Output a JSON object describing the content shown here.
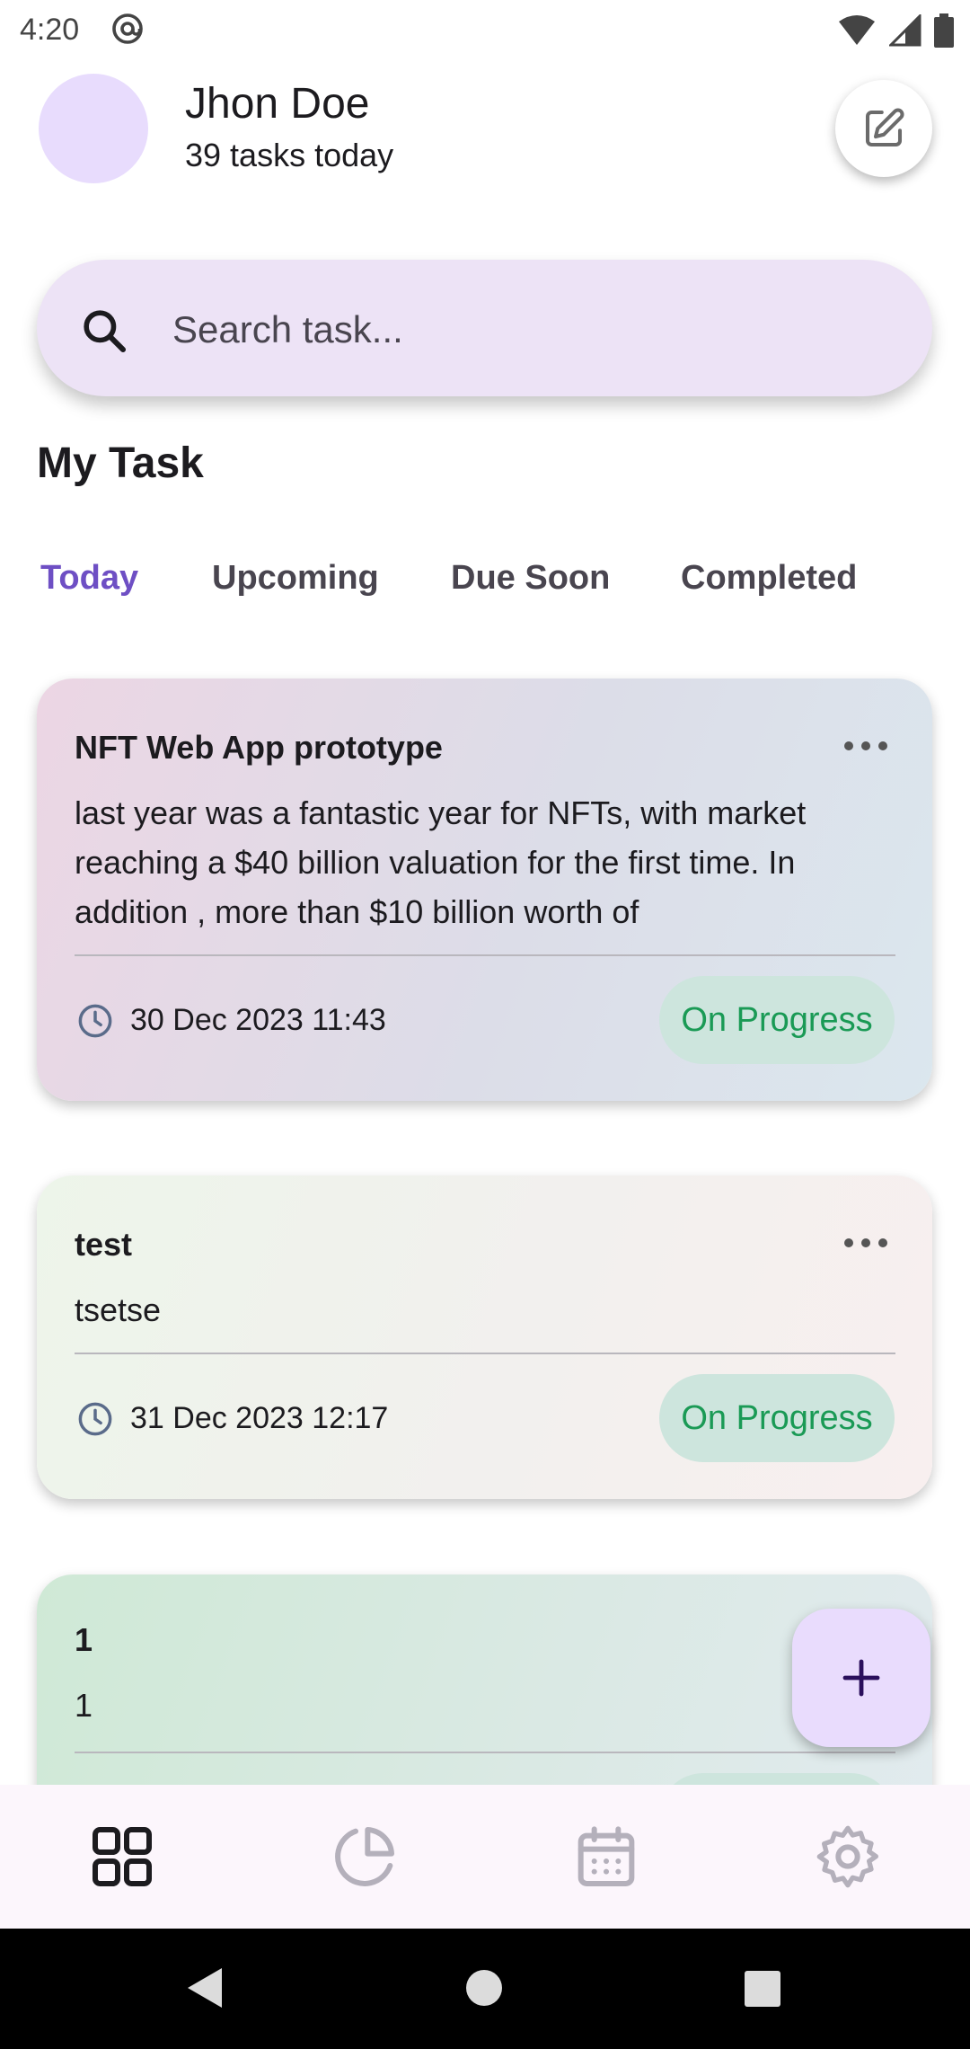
{
  "status_bar": {
    "time": "4:20"
  },
  "header": {
    "user_name": "Jhon Doe",
    "task_count": "39 tasks today"
  },
  "search": {
    "placeholder": "Search task..."
  },
  "section_title": "My Task",
  "tabs": [
    {
      "label": "Today",
      "active": true
    },
    {
      "label": "Upcoming",
      "active": false
    },
    {
      "label": "Due Soon",
      "active": false
    },
    {
      "label": "Completed",
      "active": false
    }
  ],
  "tasks": [
    {
      "title": "NFT Web App prototype",
      "description": "last year was a fantastic year for NFTs, with market reaching a $40 billion valuation for the first time. In addition , more than $10 billion worth of",
      "date": "30 Dec 2023 11:43",
      "status": "On Progress"
    },
    {
      "title": "test",
      "description": "tsetse",
      "date": "31 Dec 2023 12:17",
      "status": "On Progress"
    },
    {
      "title": "1",
      "description": "1",
      "date": "",
      "status": ""
    }
  ],
  "bottom_nav": [
    {
      "icon": "grid-icon",
      "active": true
    },
    {
      "icon": "pie-chart-icon",
      "active": false
    },
    {
      "icon": "calendar-icon",
      "active": false
    },
    {
      "icon": "gear-icon",
      "active": false
    }
  ],
  "colors": {
    "accent": "#6e4fc4",
    "status_text": "#1a9a55",
    "status_bg": "#cde5dd",
    "search_bg": "#ede3f6",
    "fab_bg": "#e9dcfd"
  }
}
